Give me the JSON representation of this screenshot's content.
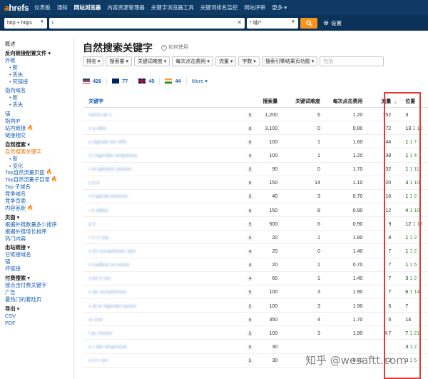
{
  "nav": {
    "logo_a": "a",
    "logo_rest": "hrefs",
    "items": [
      "仪表板",
      "通知",
      "网站浏览器",
      "内容资源管理器",
      "关键字浏览器工具",
      "关键词排名监控",
      "网站评审",
      "更多"
    ]
  },
  "search": {
    "protocol": "http + https",
    "url": "r",
    "mode": "*.域/*",
    "settings_label": "设置"
  },
  "sidebar": {
    "overview": "概述",
    "backlink_profile": "反向链接配置文件",
    "external_links": "外链",
    "ext_new": "新",
    "ext_lost": "丢失",
    "ext_broken": "死链接",
    "ref_domains": "指向域名",
    "ref_new": "新",
    "ref_lost": "丢失",
    "anchors": "锚",
    "ref_ips": "指向IP",
    "internal_links": "站内链接",
    "link_intersect": "链接相交",
    "organic_search": "自然搜索",
    "organic_keywords": "自然搜索关键字",
    "ok_new": "新",
    "ok_changes": "变化",
    "top_pages": "Top自然流量页面",
    "top_subfolders": "Top自然流量子目录",
    "top_subdomains": "Top 子域名",
    "competing_domains": "竞争域名",
    "competing_pages": "竞争页面",
    "content_gap": "内容差距",
    "pages": "页面",
    "best_by_links": "根据外链数量多少排序",
    "best_by_growth": "根据外链增长排序",
    "top_content": "热门内容",
    "outgoing_links": "出站链接",
    "linked_domains": "已链接域名",
    "out_anchors": "锚",
    "broken_links": "坏链接",
    "paid_search": "付费搜索",
    "ppc_keywords": "按点击付费关键字",
    "ads": "广告",
    "top_landing": "最热门的着陆页",
    "export": "导出",
    "csv": "CSV",
    "pdf": "PDF"
  },
  "main": {
    "title": "自然搜索关键字",
    "howto": "如何使用",
    "filters": [
      "排名",
      "搜索量",
      "关键词难度",
      "每次点击费用",
      "流量",
      "字数",
      "搜索引擎结果页功能"
    ],
    "filter_placeholder": "包括",
    "countries": [
      {
        "code": "us",
        "count": "426",
        "color": "#3c3b6e"
      },
      {
        "code": "au",
        "count": "77",
        "color": "#012169"
      },
      {
        "code": "gb",
        "count": "45",
        "color": "#c8102e"
      },
      {
        "code": "in",
        "count": "44",
        "color": "#ff9933"
      }
    ],
    "more": "More"
  },
  "table": {
    "headers": {
      "keyword": "关键字",
      "volume": "搜索量",
      "kd": "关键词难度",
      "cpc": "每次点击费用",
      "traffic": "流量",
      "position": "位置"
    },
    "rows": [
      {
        "kw": "micro air c",
        "n": "5",
        "vol": "1,200",
        "kd": "6",
        "cpc": "1.20",
        "tr": "152",
        "pos": "3",
        "extra": ""
      },
      {
        "kw": "v a   ditio",
        "n": "8",
        "vol": "3,100",
        "kd": "0",
        "cpc": "0.80",
        "tr": "72",
        "pos": "13",
        "extra": "1 12"
      },
      {
        "kw": "s   rigerati  om   ellic",
        "n": "6",
        "vol": "100",
        "kd": "1",
        "cpc": "1.60",
        "tr": "44",
        "pos": "1",
        "extra": "1 7"
      },
      {
        "kw": "s   l rigeratio   ompresso",
        "n": "4",
        "vol": "100",
        "kd": "1",
        "cpc": "1.20",
        "tr": "38",
        "pos": "1",
        "extra": "1 4"
      },
      {
        "kw": "r   re   igerator   presso",
        "n": "5",
        "vol": "90",
        "kd": "0",
        "cpc": "1.70",
        "tr": "32",
        "pos": "1",
        "extra": "1 11"
      },
      {
        "kw": "s   p   it",
        "n": "5",
        "vol": "150",
        "kd": "14",
        "cpc": "1.10",
        "tr": "20",
        "pos": "3",
        "extra": "1 10"
      },
      {
        "kw": "l   o   igerati  pressor",
        "n": "5",
        "vol": "40",
        "kd": "3",
        "cpc": "0.70",
        "tr": "16",
        "pos": "1",
        "extra": "1 2"
      },
      {
        "kw": "r   e   aditio",
        "n": "6",
        "vol": "150",
        "kd": "8",
        "cpc": "0.90",
        "tr": "12",
        "pos": "4",
        "extra": "1 10"
      },
      {
        "kw": "   p   it",
        "n": "5",
        "vol": "500",
        "kd": "6",
        "cpc": "0.90",
        "tr": "9",
        "pos": "12",
        "extra": "1 13"
      },
      {
        "kw": "r   n   i   r   ssc",
        "n": "5",
        "vol": "20",
        "kd": "1",
        "cpc": "1.80",
        "tr": "8",
        "pos": "1",
        "extra": "1 2"
      },
      {
        "kw": "s   ini   compressor   ator",
        "n": "4",
        "vol": "20",
        "kd": "0",
        "cpc": "1.40",
        "tr": "7",
        "pos": "1",
        "extra": "1 2"
      },
      {
        "kw": "s   mallest   co   resso",
        "n": "4",
        "vol": "20",
        "kd": "1",
        "cpc": "0.70",
        "tr": "7",
        "pos": "1",
        "extra": "1 5"
      },
      {
        "kw": "s   ke   ir   sor",
        "n": "4",
        "vol": "60",
        "kd": "1",
        "cpc": "1.40",
        "tr": "7",
        "pos": "3",
        "extra": "1 2"
      },
      {
        "kw": "s   air   compressor",
        "n": "5",
        "vol": "100",
        "kd": "3",
        "cpc": "1.90",
        "tr": "7",
        "pos": "6",
        "extra": "1 14"
      },
      {
        "kw": "s   al   or   rigerato   nposs",
        "n": "5",
        "vol": "100",
        "kd": "3",
        "cpc": "1.90",
        "tr": "5",
        "pos": "7",
        "extra": ""
      },
      {
        "kw": "   m   unit",
        "n": "5",
        "vol": "350",
        "kd": "4",
        "cpc": "1.70",
        "tr": "5",
        "pos": "14",
        "extra": ""
      },
      {
        "kw": "   t   ac   ressor",
        "n": "5",
        "vol": "100",
        "kd": "3",
        "cpc": "1.90",
        "tr": "4.7",
        "pos": "7",
        "extra": "1 21"
      },
      {
        "kw": "n   r   ate   ompresso",
        "n": "5",
        "vol": "30",
        "kd": "",
        "cpc": "",
        "tr": "",
        "pos": "3",
        "extra": "1 2"
      },
      {
        "kw": "s   ir   n   sor",
        "n": "5",
        "vol": "30",
        "kd": "",
        "cpc": "0.70",
        "tr": "4.2",
        "pos": "3",
        "extra": "1 5"
      }
    ]
  },
  "watermark": "知乎 @wesaftt.com",
  "colors": {
    "nav": "#0d3b66",
    "accent": "#f7931e",
    "link": "#1a5fb4",
    "highlight": "#e53935",
    "positive": "#2c9d3a"
  }
}
